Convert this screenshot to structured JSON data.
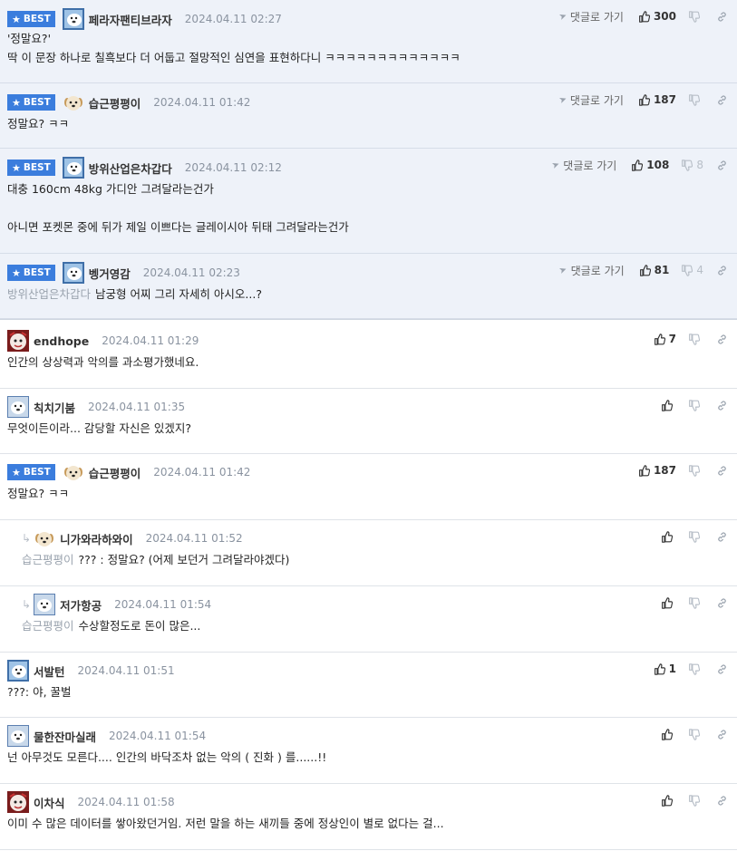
{
  "labels": {
    "best": "BEST",
    "goto": "댓글로 가기"
  },
  "colors": {
    "best_bg": "#eef2f9",
    "badge": "#3b7ddd",
    "mention": "#9aa3ae"
  },
  "comments": [
    {
      "best": true,
      "avatar": "polarbear",
      "nick": "페라자팬티브라자",
      "date": "2024.04.11 02:27",
      "lines": [
        "'정말요?'",
        "딱 이 문장 하나로 칠흑보다 더 어둡고 절망적인 심연을 표현하다니 ㅋㅋㅋㅋㅋㅋㅋㅋㅋㅋㅋㅋㅋ"
      ],
      "goto": true,
      "up": "300",
      "down": ""
    },
    {
      "best": true,
      "avatar": "puppy",
      "nick": "습근평평이",
      "date": "2024.04.11 01:42",
      "lines": [
        "정말요? ㅋㅋ"
      ],
      "goto": true,
      "up": "187",
      "down": ""
    },
    {
      "best": true,
      "avatar": "polarbear",
      "nick": "방위산업은차갑다",
      "date": "2024.04.11 02:12",
      "lines": [
        "대충 160cm 48kg 가디안 그려달라는건가",
        "",
        "아니면 포켓몬 중에 뒤가 제일 이쁘다는 글레이시아 뒤태 그려달라는건가"
      ],
      "goto": true,
      "up": "108",
      "down": "8"
    },
    {
      "best": true,
      "avatar": "polarbear",
      "nick": "벵거영감",
      "date": "2024.04.11 02:23",
      "mention": "방위산업은차갑다",
      "lines": [
        "남궁형 어찌 그리 자세히 아시오...?"
      ],
      "goto": true,
      "up": "81",
      "down": "4"
    },
    {
      "avatar": "redface",
      "nick": "endhope",
      "date": "2024.04.11 01:29",
      "lines": [
        "인간의 상상력과 악의를 과소평가했네요."
      ],
      "up": "7",
      "down": ""
    },
    {
      "avatar": "polarbear2",
      "nick": "칙치기붐",
      "date": "2024.04.11 01:35",
      "lines": [
        "무엇이든이라... 감당할 자신은 있겠지?"
      ],
      "up": "",
      "down": ""
    },
    {
      "best": true,
      "avatar": "puppy",
      "nick": "습근평평이",
      "date": "2024.04.11 01:42",
      "lines": [
        "정말요? ㅋㅋ"
      ],
      "up": "187",
      "down": "",
      "plain": true
    },
    {
      "reply": true,
      "avatar": "puppy",
      "nick": "니가와라하와이",
      "date": "2024.04.11 01:52",
      "mention": "습근평평이",
      "lines": [
        "??? : 정말요? (어제 보던거 그려달라야겠다)"
      ],
      "up": "",
      "down": ""
    },
    {
      "reply": true,
      "avatar": "polarbear2",
      "nick": "저가항공",
      "date": "2024.04.11 01:54",
      "mention": "습근평평이",
      "lines": [
        "수상할정도로 돈이 많은..."
      ],
      "up": "",
      "down": ""
    },
    {
      "avatar": "polarbear",
      "nick": "서발턴",
      "date": "2024.04.11 01:51",
      "lines": [
        "???: 야, 꿀벌"
      ],
      "up": "1",
      "down": ""
    },
    {
      "avatar": "polarbear2",
      "nick": "물한잔마실래",
      "date": "2024.04.11 01:54",
      "lines": [
        "넌 아무것도 모른다.... 인간의 바닥조차 없는 악의 ( 진화 ) 를......!!"
      ],
      "up": "",
      "down": ""
    },
    {
      "avatar": "redface",
      "nick": "이차식",
      "date": "2024.04.11 01:58",
      "lines": [
        "이미 수 많은 데이터를 쌓아왔던거임. 저런 말을 하는 새끼들 중에 정상인이 별로 없다는 걸..."
      ],
      "up": "",
      "down": ""
    }
  ]
}
